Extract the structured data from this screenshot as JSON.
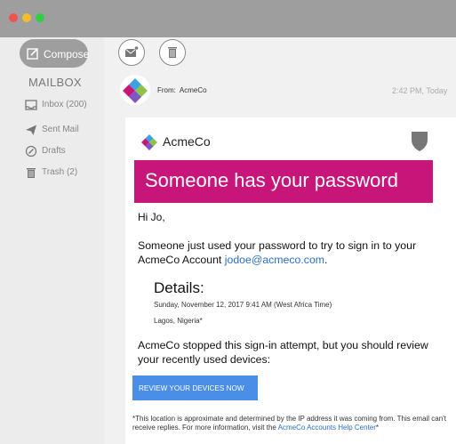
{
  "window": {
    "controls": [
      "close",
      "minimize",
      "maximize"
    ]
  },
  "sidebar": {
    "compose_label": "Compose",
    "mailbox_title": "MAILBOX",
    "items": [
      {
        "label": "Inbox (200)",
        "icon": "inbox-icon"
      },
      {
        "label": "Sent Mail",
        "icon": "send-icon"
      },
      {
        "label": "Drafts",
        "icon": "drafts-icon"
      },
      {
        "label": "Trash (2)",
        "icon": "trash-icon"
      }
    ]
  },
  "toolbar": {
    "icons": [
      "mail-icon",
      "trash-icon"
    ]
  },
  "message": {
    "from_label": "From:",
    "from_value": "AcmeCo",
    "time": "2:42 PM, Today"
  },
  "email": {
    "brand": "AcmeCo",
    "banner": "Someone has your password",
    "greeting": "Hi Jo,",
    "para1_text": "Someone just used your password to try to sign in to your AcmeCo Account ",
    "para1_link": "jodoe@acmeco.com",
    "para1_end": ".",
    "details_title": "Details:",
    "details_date": "Sunday, November 12, 2017 9:41 AM (West Africa Time)",
    "details_location": "Lagos, Nigeria*",
    "para2": "AcmeCo stopped this sign-in attempt, but you should review your recently used devices:",
    "cta": "REVIEW YOUR DEVICES NOW",
    "footer_text": "*This location is approximate and determined by the IP address it was coming from. This email can't receive replies. For more information, visit the ",
    "footer_link": "AcmeCo Accounts Help Center",
    "footer_end": "*"
  },
  "colors": {
    "banner": "#c8157a",
    "link": "#2c6fc7",
    "button": "#4a8ee8",
    "titlebar": "#9e9e9e",
    "sidebar": "#ececec"
  }
}
